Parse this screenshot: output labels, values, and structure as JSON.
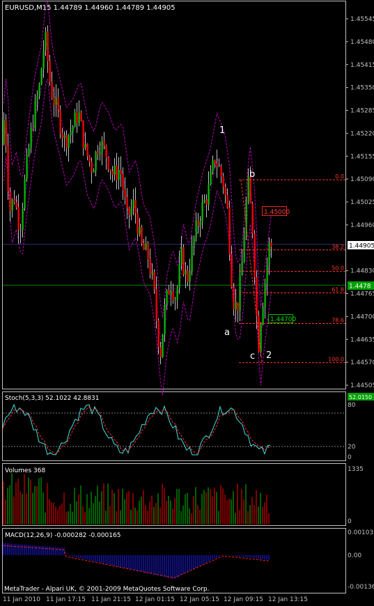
{
  "header": {
    "title": "EURUSD,M15  1.44789 1.44960 1.44789 1.44905"
  },
  "colors": {
    "background": "#000000",
    "frame": "#c0c0c0",
    "bull": "#00c000",
    "bear": "#ff0000",
    "wick": "#c0c0c0",
    "envelope": "#c000c0",
    "fib": "#ff3a2a",
    "stoch_main": "#40e0e0",
    "stoch_signal": "#ff3030",
    "macd_hist": "#2020ff",
    "macd_signal": "#ff2020",
    "price_label_bg": "#ffffff",
    "green_label": "#00a000",
    "red_label": "#c00000"
  },
  "chart_data": [
    {
      "type": "candlestick",
      "name": "main",
      "ylim": [
        1.4444,
        1.456
      ],
      "yticks": [
        "1.45545",
        "1.45480",
        "1.45415",
        "1.45350",
        "1.45285",
        "1.45220",
        "1.45155",
        "1.45090",
        "1.45025",
        "1.44960",
        "1.44830",
        "1.44765",
        "1.44700",
        "1.44635",
        "1.44570",
        "1.44505"
      ],
      "current_price": "1.44905",
      "green_line_price": "1.44789",
      "green_line_label": "1.4478",
      "red_box_label": "1.45000",
      "green_box_label": "1.44700",
      "wave_labels": [
        "1",
        "b",
        "a",
        "c",
        "2"
      ],
      "fib_levels": [
        {
          "label": "0.0",
          "price": 1.45088
        },
        {
          "label": "38.2",
          "price": 1.44889
        },
        {
          "label": "50.0",
          "price": 1.44828
        },
        {
          "label": "61.8",
          "price": 1.44767
        },
        {
          "label": "78.6",
          "price": 1.4468
        },
        {
          "label": "100.0",
          "price": 1.44569
        }
      ]
    },
    {
      "type": "line",
      "name": "Stoch(5,3,3)",
      "label": "Stoch(5,3,3) 52.1022 42.8831",
      "ylim": [
        0,
        100
      ],
      "yticks": [
        "80",
        "20",
        "0"
      ],
      "right_label": "52.0150"
    },
    {
      "type": "bar",
      "name": "Volumes",
      "label": "Volumes 368",
      "yticks": [
        "1335",
        "0"
      ]
    },
    {
      "type": "bar",
      "name": "MACD(12,26,9)",
      "label": "MACD(12,26,9) -0.000282 -0.000165",
      "yticks": [
        "0.00103",
        "0.00",
        "-0.00136"
      ]
    }
  ],
  "xaxis": {
    "labels": [
      "11 Jan 2010",
      "11 Jan 17:15",
      "11 Jan 21:15",
      "12 Jan 01:15",
      "12 Jan 05:15",
      "12 Jan 09:15",
      "12 Jan 13:15"
    ]
  },
  "footer": {
    "copyright": "MetaTrader - Alpari UK, © 2001-2009 MetaQuotes Software Corp."
  }
}
